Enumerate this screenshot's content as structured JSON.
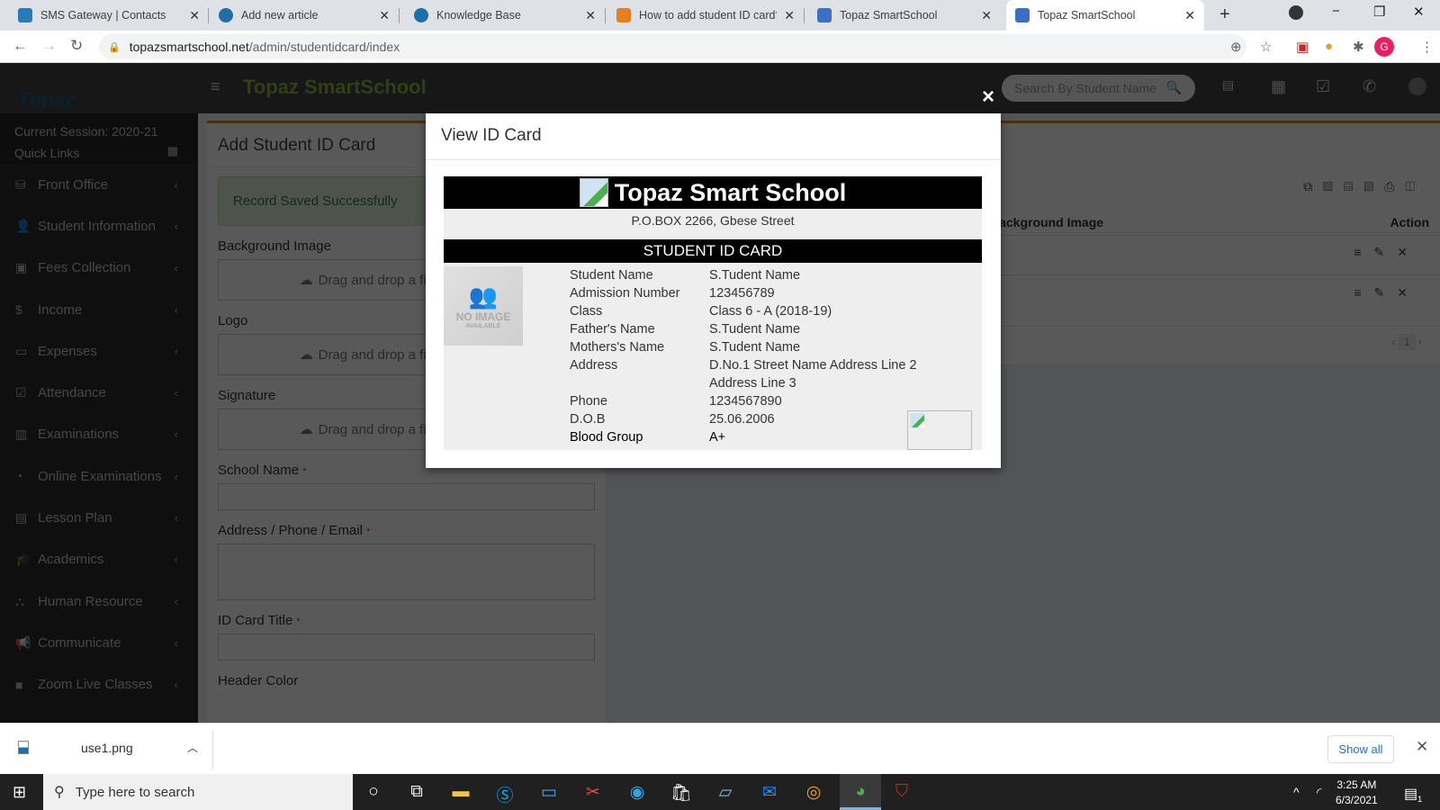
{
  "browser": {
    "tabs": [
      {
        "title": "SMS Gateway | Contacts",
        "favicon": "topaz-favicon",
        "color": "#2a7ab8"
      },
      {
        "title": "Add new article",
        "favicon": "s-favicon",
        "color": "#1e6fa8"
      },
      {
        "title": "Knowledge Base",
        "favicon": "s-favicon",
        "color": "#1e6fa8"
      },
      {
        "title": "How to add student ID card? -",
        "favicon": "book-favicon",
        "color": "#e67e22"
      },
      {
        "title": "Topaz SmartSchool",
        "favicon": "topaz-favicon",
        "color": "#3b6fc5"
      },
      {
        "title": "Topaz SmartSchool",
        "favicon": "topaz-favicon",
        "color": "#3b6fc5",
        "active": true
      }
    ],
    "url_host": "topazsmartschool.net",
    "url_path": "/admin/studentidcard/index",
    "profile_initial": "G",
    "profile_color": "#e91e63"
  },
  "app": {
    "logo_text": "Topaz SmartSchool",
    "brand": "Topaz SmartSchool",
    "search_placeholder": "Search By Student Name",
    "session_label": "Current Session: 2020-21",
    "quick_links": "Quick Links",
    "menu": [
      {
        "label": "Front Office",
        "icon": "front-office-icon",
        "glyph": "⛁"
      },
      {
        "label": "Student Information",
        "icon": "user-plus-icon",
        "glyph": "👤"
      },
      {
        "label": "Fees Collection",
        "icon": "money-icon",
        "glyph": "▣"
      },
      {
        "label": "Income",
        "icon": "dollar-icon",
        "glyph": "$"
      },
      {
        "label": "Expenses",
        "icon": "credit-card-icon",
        "glyph": "▭"
      },
      {
        "label": "Attendance",
        "icon": "calendar-check-icon",
        "glyph": "☑"
      },
      {
        "label": "Examinations",
        "icon": "map-icon",
        "glyph": "▥"
      },
      {
        "label": "Online Examinations",
        "icon": "rss-icon",
        "glyph": "◔"
      },
      {
        "label": "Lesson Plan",
        "icon": "list-alt-icon",
        "glyph": "▤"
      },
      {
        "label": "Academics",
        "icon": "graduation-cap-icon",
        "glyph": "🎓"
      },
      {
        "label": "Human Resource",
        "icon": "sitemap-icon",
        "glyph": "⛬"
      },
      {
        "label": "Communicate",
        "icon": "bullhorn-icon",
        "glyph": "📢"
      },
      {
        "label": "Zoom Live Classes",
        "icon": "video-camera-icon",
        "glyph": "■"
      }
    ]
  },
  "form": {
    "title": "Add Student ID Card",
    "success_message": "Record Saved Successfully",
    "background_image_label": "Background Image",
    "logo_label": "Logo",
    "signature_label": "Signature",
    "drop_text": "Drag and drop a file here or click",
    "school_name_label": "School Name",
    "address_label": "Address / Phone / Email",
    "id_card_title_label": "ID Card Title",
    "header_color_label": "Header Color",
    "required_mark": "*"
  },
  "list": {
    "column_background": "Background Image",
    "column_action": "Action",
    "page": "1"
  },
  "modal": {
    "title": "View ID Card",
    "close": "×",
    "card": {
      "school_name": "Topaz Smart School",
      "address": "P.O.BOX 2266, Gbese Street",
      "title": "STUDENT ID CARD",
      "photo_text_1": "NO IMAGE",
      "photo_text_2": "AVAILABLE",
      "fields": [
        {
          "label": "Student Name",
          "value": "S.Tudent Name"
        },
        {
          "label": "Admission Number",
          "value": "123456789"
        },
        {
          "label": "Class",
          "value": "Class 6 - A (2018-19)"
        },
        {
          "label": "Father's Name",
          "value": "S.Tudent Name"
        },
        {
          "label": "Mothers's Name",
          "value": "S.Tudent Name"
        },
        {
          "label": "Address",
          "value": "D.No.1 Street Name Address Line 2"
        },
        {
          "label": "",
          "value": "Address Line 3"
        },
        {
          "label": "Phone",
          "value": "1234567890"
        },
        {
          "label": "D.O.B",
          "value": "25.06.2006"
        },
        {
          "label": "Blood Group",
          "value": "A+"
        }
      ]
    }
  },
  "downloads": {
    "file": "use1.png",
    "show_all": "Show all"
  },
  "taskbar": {
    "search_placeholder": "Type here to search",
    "time": "3:25 AM",
    "date": "6/3/2021",
    "notifications": "1"
  }
}
